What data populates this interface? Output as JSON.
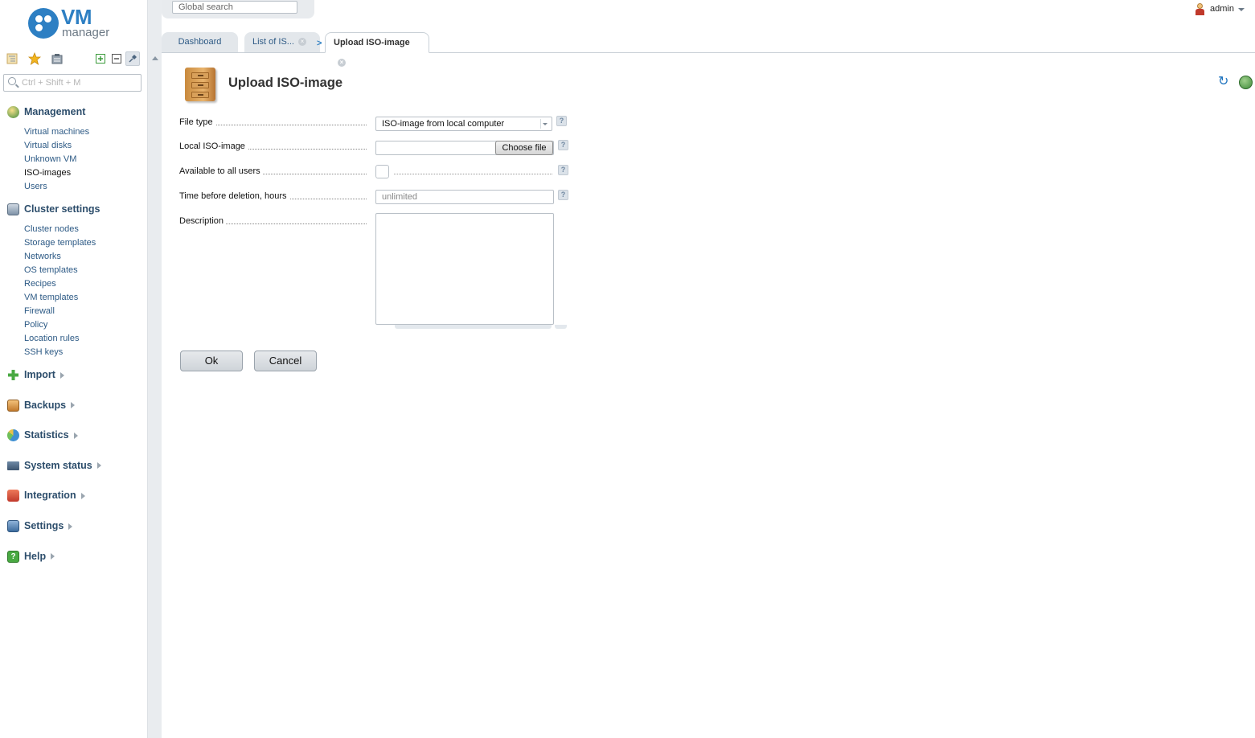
{
  "app": {
    "logo_primary": "VM",
    "logo_secondary": "manager",
    "brand_color": "#2d7fc3"
  },
  "sidebar": {
    "search_placeholder": "Ctrl + Shift + M",
    "toolbar_icons": [
      "tree-view-icon",
      "favorites-star-icon",
      "clipboard-icon",
      "expand-all-icon",
      "collapse-all-icon",
      "pin-icon"
    ],
    "groups": [
      {
        "title": "Management",
        "icon": "management-icon",
        "items": [
          "Virtual machines",
          "Virtual disks",
          "Unknown VM",
          "ISO-images",
          "Users"
        ],
        "current": "ISO-images"
      },
      {
        "title": "Cluster settings",
        "icon": "cluster-settings-icon",
        "items": [
          "Cluster nodes",
          "Storage templates",
          "Networks",
          "OS templates",
          "Recipes",
          "VM templates",
          "Firewall",
          "Policy",
          "Location rules",
          "SSH keys"
        ]
      }
    ],
    "collapsed_groups": [
      {
        "title": "Import",
        "icon": "import-icon"
      },
      {
        "title": "Backups",
        "icon": "backups-icon"
      },
      {
        "title": "Statistics",
        "icon": "statistics-icon"
      },
      {
        "title": "System status",
        "icon": "system-status-icon"
      },
      {
        "title": "Integration",
        "icon": "integration-icon"
      },
      {
        "title": "Settings",
        "icon": "settings-icon"
      },
      {
        "title": "Help",
        "icon": "help-icon"
      }
    ]
  },
  "header": {
    "global_search_placeholder": "Global search",
    "user_name": "admin"
  },
  "tabs": [
    {
      "label": "Dashboard",
      "closable": false
    },
    {
      "label": "List of IS...",
      "closable": true
    },
    {
      "label": "Upload ISO-image",
      "closable": true,
      "active": true
    }
  ],
  "tab_separator": ">",
  "page": {
    "title": "Upload ISO-image",
    "icon": "file-cabinet-icon"
  },
  "form": {
    "file_type": {
      "label": "File type",
      "value": "ISO-image from local computer"
    },
    "local_iso": {
      "label": "Local ISO-image",
      "button_label": "Choose file"
    },
    "available_all": {
      "label": "Available to all users",
      "checked": false
    },
    "time_before_deletion": {
      "label": "Time before deletion, hours",
      "placeholder": "unlimited"
    },
    "description": {
      "label": "Description",
      "value": ""
    },
    "help_glyph": "?",
    "ok_label": "Ok",
    "cancel_label": "Cancel"
  }
}
